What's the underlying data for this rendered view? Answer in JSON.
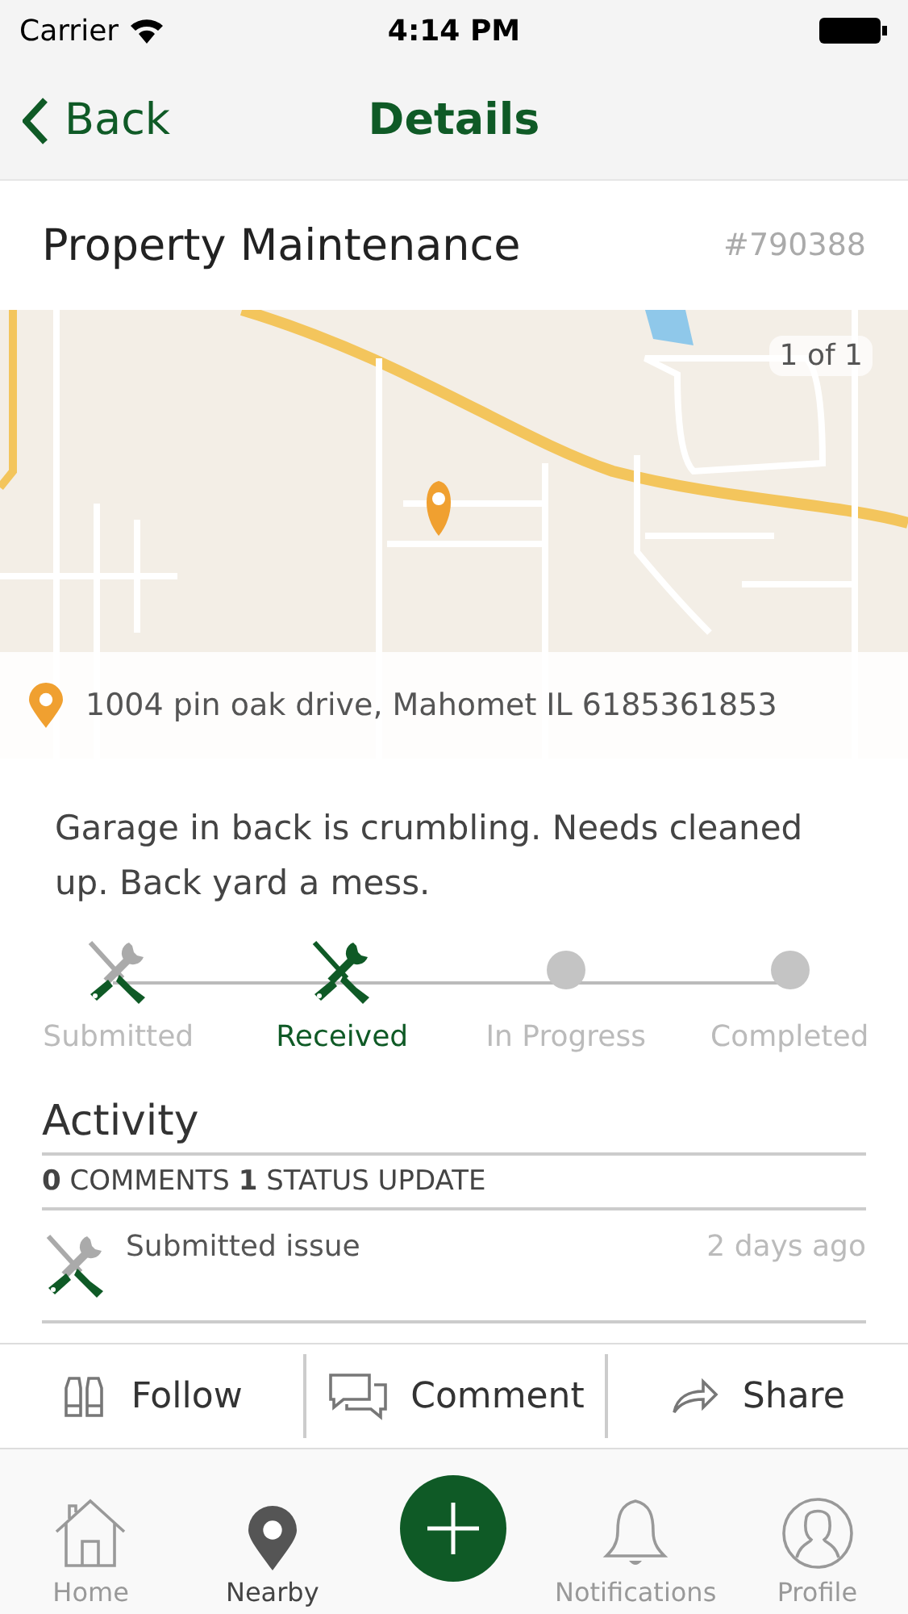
{
  "status_bar": {
    "carrier": "Carrier",
    "time": "4:14 PM"
  },
  "nav": {
    "back": "Back",
    "title": "Details"
  },
  "issue": {
    "title": "Property Maintenance",
    "number": "#790388"
  },
  "map": {
    "kind": "picture",
    "pager": "1 of 1",
    "address": "1004 pin oak drive, Mahomet IL 6185361853"
  },
  "description": "Garage in back is crumbling. Needs cleaned up. Back yard a mess.",
  "progress": [
    {
      "kind": "tools",
      "label": "Submitted",
      "selected": false
    },
    {
      "kind": "tools",
      "label": "Received",
      "selected": true
    },
    {
      "kind": "dot",
      "label": "In Progress",
      "selected": false
    },
    {
      "kind": "dot",
      "label": "Completed",
      "selected": false
    }
  ],
  "activity": {
    "title": "Activity",
    "counts": "**0** COMMENTS **1** STATUS UPDATE",
    "items": [
      {
        "text": "Submitted issue",
        "time": "2 days ago"
      }
    ]
  },
  "actions": [
    {
      "kind": "follow",
      "label": "Follow"
    },
    {
      "kind": "comment",
      "label": "Comment"
    },
    {
      "kind": "share",
      "label": "Share"
    }
  ],
  "tabs": [
    {
      "kind": "home",
      "label": "Home",
      "selected": false
    },
    {
      "kind": "nearby",
      "label": "Nearby",
      "selected": true
    },
    {
      "kind": "add"
    },
    {
      "kind": "notifications",
      "label": "Notifications",
      "selected": false
    },
    {
      "kind": "profile",
      "label": "Profile",
      "selected": false
    }
  ]
}
